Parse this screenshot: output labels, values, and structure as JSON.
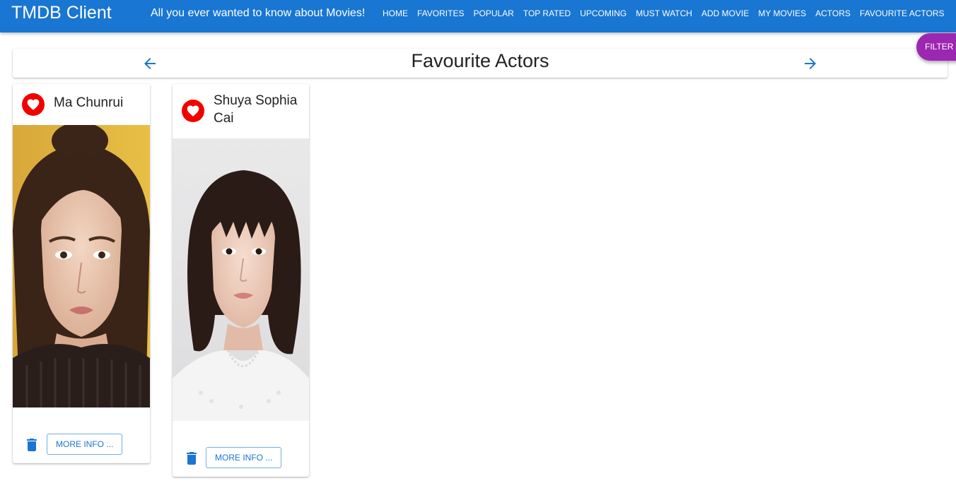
{
  "app": {
    "title": "TMDB Client",
    "tagline": "All you ever wanted to know about Movies!",
    "brand_color": "#1976d2"
  },
  "nav": {
    "items": [
      {
        "label": "HOME"
      },
      {
        "label": "FAVORITES"
      },
      {
        "label": "POPULAR"
      },
      {
        "label": "TOP RATED"
      },
      {
        "label": "UPCOMING"
      },
      {
        "label": "MUST WATCH"
      },
      {
        "label": "ADD MOVIE"
      },
      {
        "label": "MY MOVIES"
      },
      {
        "label": "ACTORS"
      },
      {
        "label": "FAVOURITE ACTORS"
      }
    ]
  },
  "header": {
    "title": "Favourite Actors",
    "back_icon": "arrow-back-icon",
    "forward_icon": "arrow-forward-icon"
  },
  "filter": {
    "label": "FILTER",
    "color": "#9c27b0"
  },
  "actors": [
    {
      "name": "Ma Chunrui",
      "favorite_icon": "heart-icon",
      "delete_icon": "trash-icon",
      "more_label": "MORE INFO ..."
    },
    {
      "name": "Shuya Sophia Cai",
      "favorite_icon": "heart-icon",
      "delete_icon": "trash-icon",
      "more_label": "MORE INFO ..."
    }
  ],
  "colors": {
    "favorite": "#f20000",
    "action": "#1976d2"
  }
}
